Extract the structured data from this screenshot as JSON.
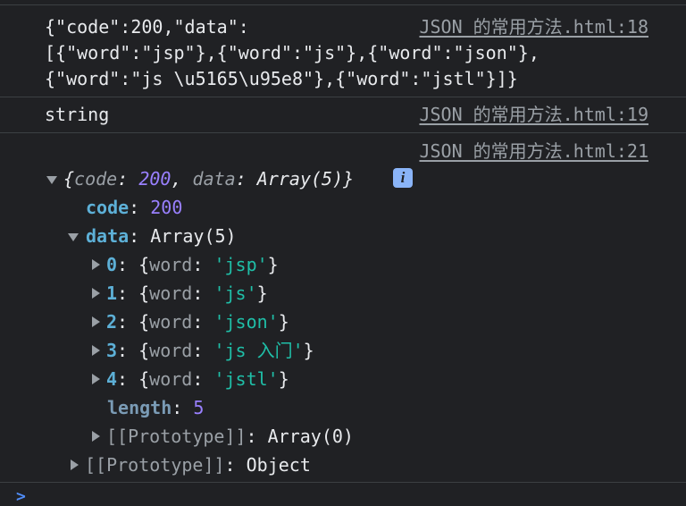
{
  "console": {
    "log1": {
      "lines": [
        "{\"code\":200,\"data\":",
        "[{\"word\":\"jsp\"},{\"word\":\"js\"},{\"word\":\"json\"},",
        "{\"word\":\"js \\u5165\\u95e8\"},{\"word\":\"jstl\"}]}"
      ],
      "source": "JSON 的常用方法.html:18"
    },
    "log2": {
      "text": "string",
      "source": "JSON 的常用方法.html:19"
    },
    "log3": {
      "source": "JSON 的常用方法.html:21",
      "summary": {
        "open": "{",
        "code_key": "code",
        "colon_space": ": ",
        "code_val": "200",
        "comma": ", ",
        "data_key": "data",
        "data_val": "Array(5)",
        "close": "}"
      },
      "info_icon": "i",
      "code_row": {
        "key": "code",
        "value": "200"
      },
      "data_row": {
        "key": "data",
        "value": "Array(5)"
      },
      "items": [
        {
          "index": "0",
          "word": "jsp"
        },
        {
          "index": "1",
          "word": "js"
        },
        {
          "index": "2",
          "word": "json"
        },
        {
          "index": "3",
          "word": "js 入门"
        },
        {
          "index": "4",
          "word": "jstl"
        }
      ],
      "word_key": "word",
      "length_row": {
        "key": "length",
        "value": "5"
      },
      "array_proto": {
        "key": "[[Prototype]]",
        "value": "Array(0)"
      },
      "object_proto": {
        "key": "[[Prototype]]",
        "value": "Object"
      }
    },
    "prompt": ">"
  },
  "colors": {
    "background": "#202124",
    "text": "#e8eaed",
    "key": "#5db0d7",
    "number": "#9980ff",
    "string": "#1fbfa8",
    "link": "#9aa0a6"
  }
}
